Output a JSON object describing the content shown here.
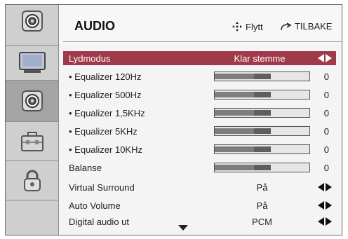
{
  "header": {
    "title": "AUDIO",
    "move_hint": "Flytt",
    "back_hint": "TILBAKE"
  },
  "sidebar": {
    "items": [
      {
        "name": "audio-top",
        "icon": "speaker-icon"
      },
      {
        "name": "picture",
        "icon": "tv-icon"
      },
      {
        "name": "audio",
        "icon": "speaker-icon"
      },
      {
        "name": "setup",
        "icon": "toolbox-icon"
      },
      {
        "name": "lock",
        "icon": "lock-icon"
      }
    ],
    "selected_index": 2
  },
  "menu": {
    "rows": [
      {
        "label": "Lydmodus",
        "value": "Klar stemme",
        "type": "select",
        "selected": true
      },
      {
        "label": "• Equalizer 120Hz",
        "value": "0",
        "type": "slider",
        "level": 0.5
      },
      {
        "label": "• Equalizer 500Hz",
        "value": "0",
        "type": "slider",
        "level": 0.5
      },
      {
        "label": "• Equalizer 1,5KHz",
        "value": "0",
        "type": "slider",
        "level": 0.5
      },
      {
        "label": "• Equalizer 5KHz",
        "value": "0",
        "type": "slider",
        "level": 0.5
      },
      {
        "label": "• Equalizer 10KHz",
        "value": "0",
        "type": "slider",
        "level": 0.5
      },
      {
        "label": "Balanse",
        "value": "0",
        "type": "slider",
        "level": 0.5
      },
      {
        "label": "Virtual Surround",
        "value": "På",
        "type": "select"
      },
      {
        "label": "Auto Volume",
        "value": "På",
        "type": "select"
      },
      {
        "label": "Digital audio ut",
        "value": "PCM",
        "type": "select"
      }
    ],
    "more_indicator": "chevron-down-icon"
  },
  "colors": {
    "selection": "#9f3a4b",
    "sidebar": "#cfcfcf",
    "sidebar_selected": "#a4a4a4"
  }
}
